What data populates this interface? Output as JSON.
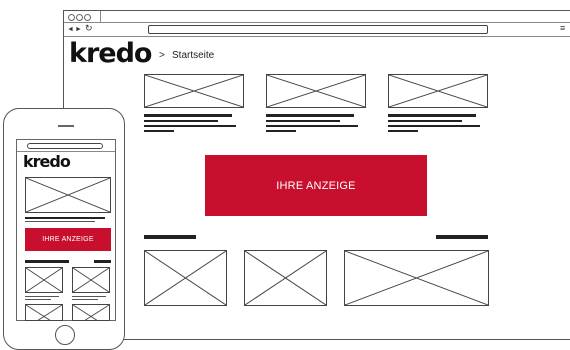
{
  "desktop": {
    "nav": {
      "back": "◄",
      "forward": "►",
      "reload": "↻",
      "menu": "≡"
    },
    "logo": "kredo",
    "breadcrumb_sep": ">",
    "breadcrumb": "Startseite",
    "ad_label": "IHRE ANZEIGE",
    "accent": "#c8102e"
  },
  "mobile": {
    "logo": "kredo",
    "ad_label": "IHRE ANZEIGE",
    "accent": "#c8102e"
  }
}
